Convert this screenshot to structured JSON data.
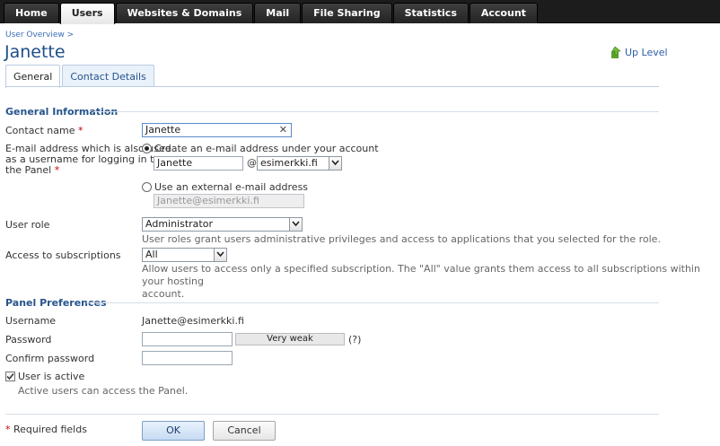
{
  "nav": {
    "tabs": [
      "Home",
      "Users",
      "Websites & Domains",
      "Mail",
      "File Sharing",
      "Statistics",
      "Account"
    ],
    "active": "Users"
  },
  "breadcrumb": "User Overview >",
  "page_title": "Janette",
  "up_level": "Up Level",
  "page_tabs": [
    "General",
    "Contact Details"
  ],
  "general": {
    "heading": "General Information",
    "contact_label": "Contact name",
    "required_mark": "*",
    "contact_value": "Janette",
    "email_label_l1": "E-mail address which is also used",
    "email_label_l2": "as a username for logging in to",
    "email_label_l3": "the Panel",
    "opt_create": "Create an e-mail address under your account",
    "email_local": "Janette",
    "at": "@",
    "email_domain": "esimerkki.fi",
    "opt_external": "Use an external e-mail address",
    "external_placeholder": "Janette@esimerkki.fi",
    "role_label": "User role",
    "role_value": "Administrator",
    "role_hint": "User roles grant users administrative privileges and access to applications that you selected for the role.",
    "subs_label": "Access to subscriptions",
    "subs_value": "All",
    "subs_hint_l1": "Allow users to access only a specified subscription. The \"All\" value grants them access to all subscriptions within your hosting",
    "subs_hint_l2": "account."
  },
  "prefs": {
    "heading": "Panel Preferences",
    "username_label": "Username",
    "username_value": "Janette@esimerkki.fi",
    "password_label": "Password",
    "strength": "Very weak",
    "strength_help": "(?)",
    "confirm_label": "Confirm password",
    "active_label": "User is active",
    "active_hint": "Active users can access the Panel.",
    "active_checked": true
  },
  "footer": {
    "required_note": "Required fields",
    "ok": "OK",
    "cancel": "Cancel"
  },
  "colors": {
    "nav_bg": "#1c1c1c",
    "heading": "#26548c",
    "title": "#1d4e89",
    "required": "#cc0000"
  }
}
